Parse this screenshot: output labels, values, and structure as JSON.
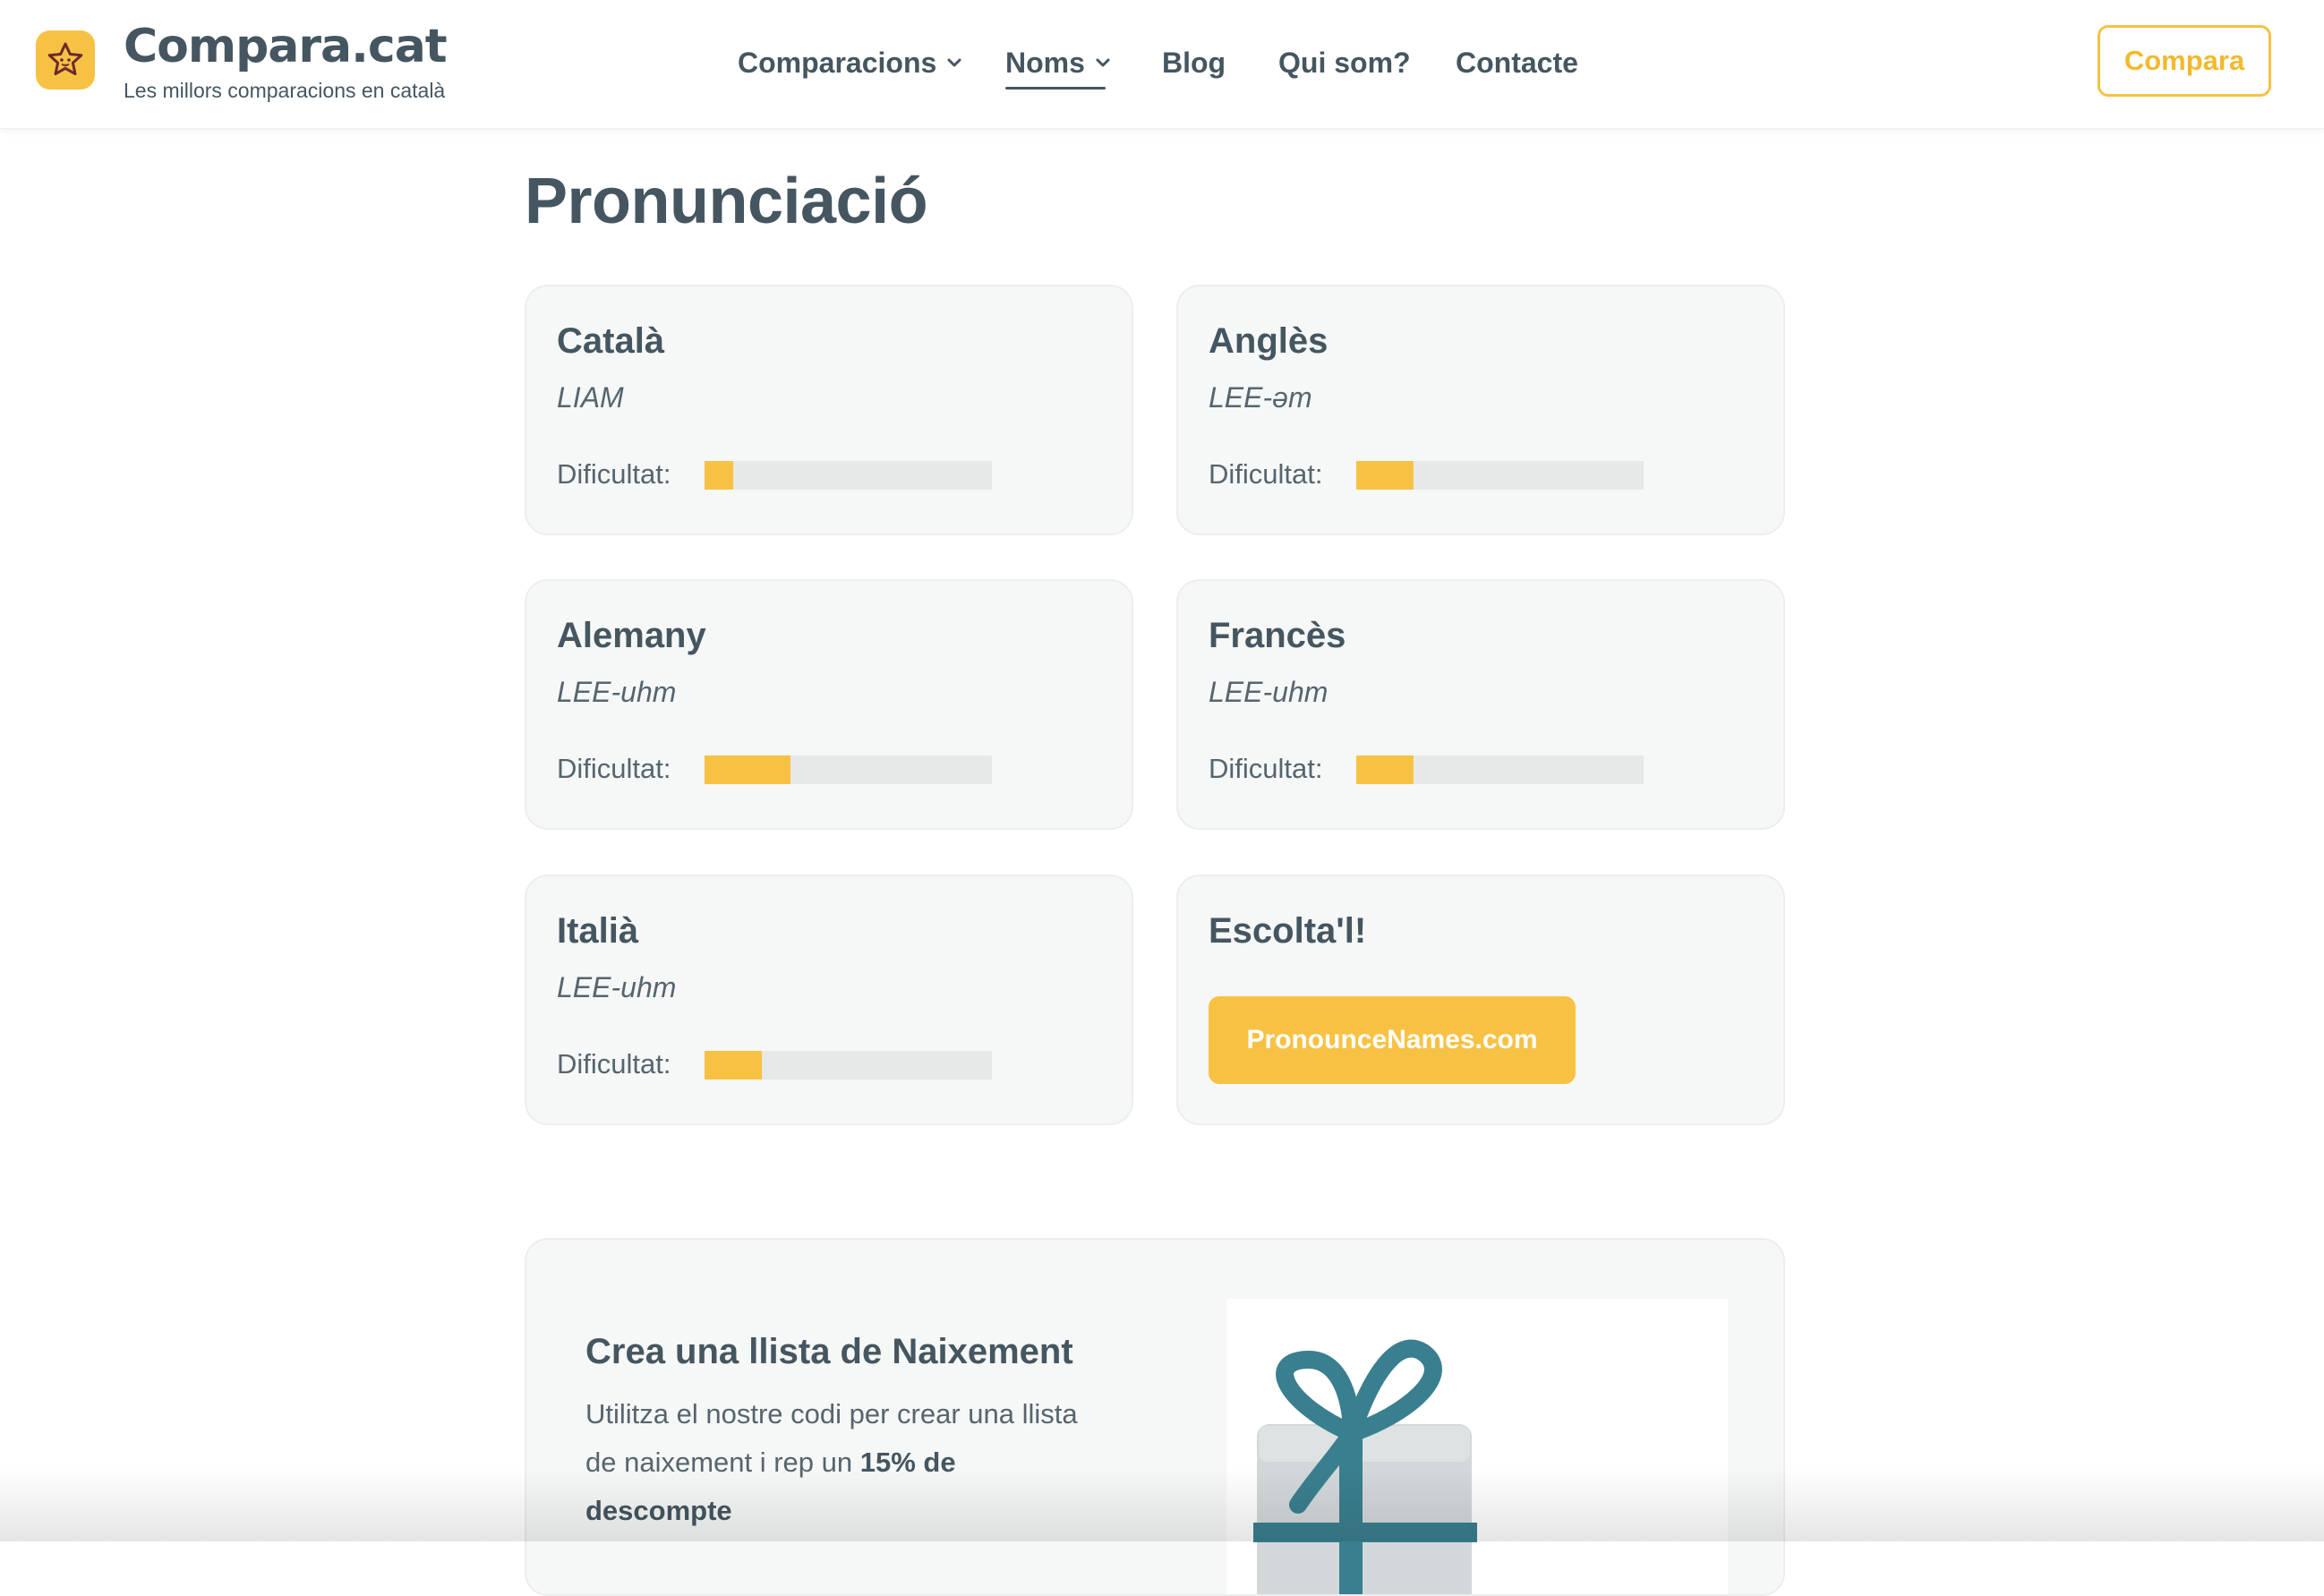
{
  "header": {
    "logo_icon": "star-face-icon",
    "logo_title": "Compara.cat",
    "logo_subtitle": "Les millors comparacions en català",
    "nav": [
      {
        "label": "Comparacions",
        "has_dropdown": true,
        "active": false
      },
      {
        "label": "Noms",
        "has_dropdown": true,
        "active": true
      },
      {
        "label": "Blog",
        "has_dropdown": false,
        "active": false
      },
      {
        "label": "Qui som?",
        "has_dropdown": false,
        "active": false
      },
      {
        "label": "Contacte",
        "has_dropdown": false,
        "active": false
      }
    ],
    "cta_label": "Compara"
  },
  "main": {
    "title": "Pronunciació",
    "difficulty_label": "Dificultat:",
    "languages": [
      {
        "name": "Català",
        "pronunciation": "LIAM",
        "difficulty": 0.1
      },
      {
        "name": "Anglès",
        "pronunciation": "LEE-əm",
        "difficulty": 0.2
      },
      {
        "name": "Alemany",
        "pronunciation": "LEE-uhm",
        "difficulty": 0.3
      },
      {
        "name": "Francès",
        "pronunciation": "LEE-uhm",
        "difficulty": 0.2
      },
      {
        "name": "Italià",
        "pronunciation": "LEE-uhm",
        "difficulty": 0.2
      }
    ],
    "listen": {
      "title": "Escolta'l!",
      "button_label": "PronounceNames.com"
    }
  },
  "promo": {
    "title": "Crea una llista de Naixement",
    "text": "Utilitza el nostre codi per crear una llista de naixement i rep un ",
    "text_bold": "15% de descompte",
    "image_icon": "gift-box-icon"
  },
  "colors": {
    "accent": "#f7c244",
    "text": "#455660",
    "card_bg": "#f6f7f7",
    "track": "#e7e8e8",
    "gift_ribbon": "#3a7f8f"
  }
}
